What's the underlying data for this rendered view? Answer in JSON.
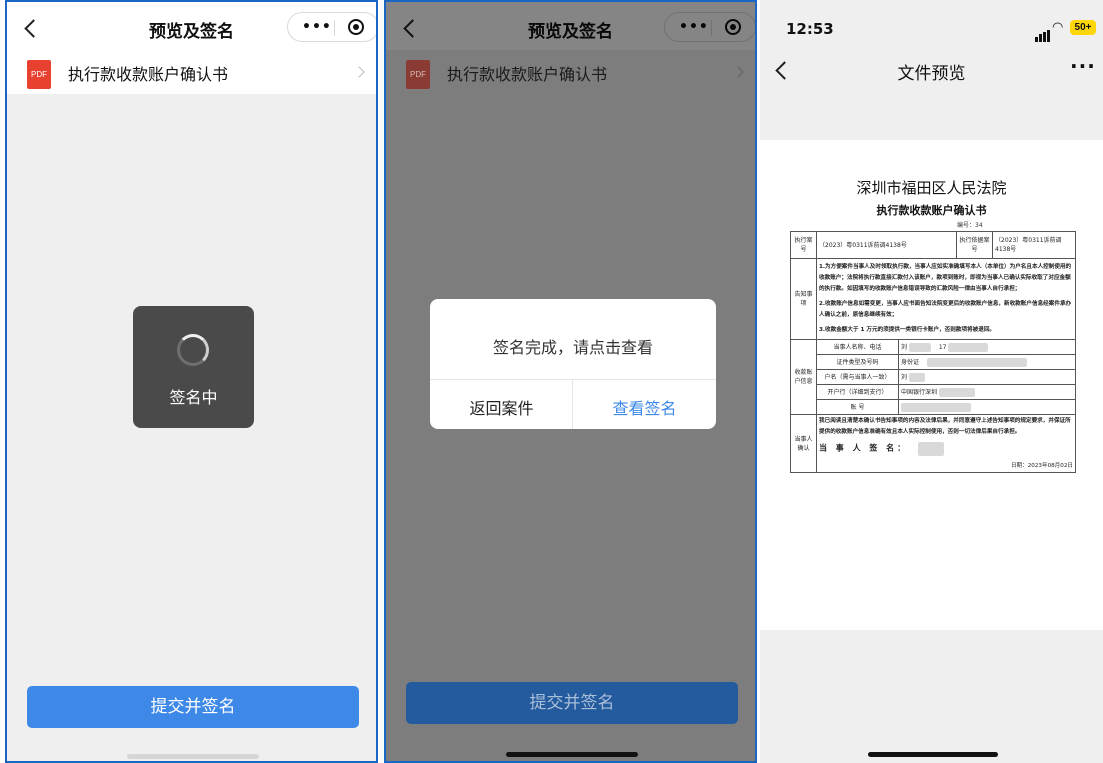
{
  "panel1": {
    "nav_title": "预览及签名",
    "file_name": "执行款收款账户确认书",
    "pdf_label": "PDF",
    "loading_text": "签名中",
    "submit_label": "提交并签名"
  },
  "panel2": {
    "nav_title": "预览及签名",
    "file_name": "执行款收款账户确认书",
    "pdf_label": "PDF",
    "dialog_message": "签名完成，请点击查看",
    "back_button": "返回案件",
    "view_button": "查看签名",
    "submit_label": "提交并签名"
  },
  "panel3": {
    "status_time": "12:53",
    "battery_level": "50+",
    "nav_title": "文件预览",
    "document": {
      "court": "深圳市福田区人民法院",
      "title": "执行款收款账户确认书",
      "number": "编号：34",
      "case_label": "执行案号",
      "case_no": "（2023）粤0311诉前调4138号",
      "basis_label": "执行依据案号",
      "basis_no": "（2023）粤0311诉前调4138号",
      "notice_label": "告知事项",
      "notice_1": "1.为方便案件当事人及时领取执行款，当事人应如实准确填写本人（本单位）为户名且本人控制使用的收款账户；法院将执行款直接汇款付入该账户，款项到账时，即视为当事人已确认实际收取了对应金额的执行款。如因填写的收款账户信息错误导致的汇款风险一律由当事人自行承担；",
      "notice_2": "2.收款账户信息如需变更，当事人应书面告知法院变更后的收款账户信息，新收款账户信息经案件承办人确认之前，原信息继续有效；",
      "notice_3": "3.收款金额大于 1 万元的须提供一类银行卡账户，否则款项将被退回。",
      "account_label": "收款账户信息",
      "party_name_label": "当事人名称、电话",
      "party_name_value": "刘",
      "party_phone_value": "17",
      "id_type_label": "证件类型及号码",
      "id_type_value": "身份证",
      "holder_label": "户名（需与当事人一致）",
      "holder_value": "刘",
      "bank_label": "开户行（详细到支行）",
      "bank_value": "中国银行深圳",
      "account_no_label": "账 号",
      "confirm_label": "当事人确认",
      "confirm_text": "我已阅读且清楚本确认书告知事项的内容及法律后果，并同意遵守上述告知事项的规定要求，并保证所提供的收款账户信息准确有效且本人实际控制使用，否则一切法律后果自行承担。",
      "sign_label": "当 事 人 签 名：",
      "date": "日期：2023年08月02日"
    }
  },
  "colors": {
    "accent_blue": "#3e89e8",
    "frame_blue": "#1a66c2",
    "pdf_red": "#e8412f",
    "battery_yellow": "#ffd60a"
  }
}
